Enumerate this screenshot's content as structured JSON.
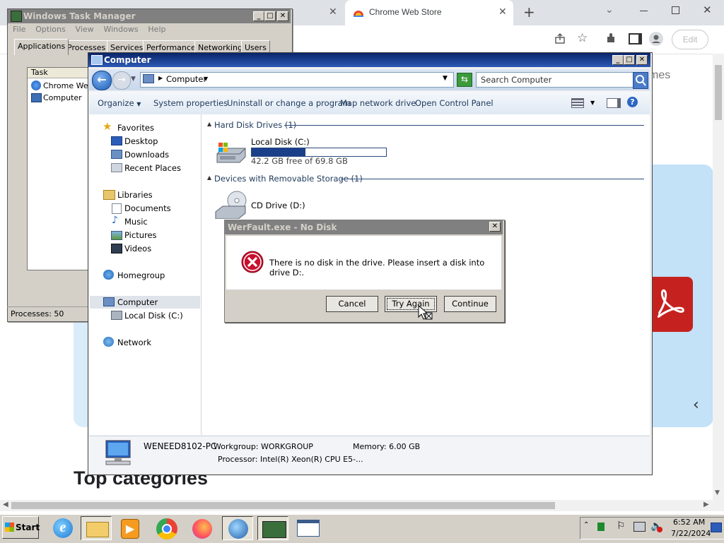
{
  "chrome": {
    "tab_active_title": "Chrome Web Store",
    "edit_label": "Edit",
    "games_partial": "mes",
    "top_categories": "Top categories"
  },
  "task_manager": {
    "title": "Windows Task Manager",
    "menus": [
      "File",
      "Options",
      "View",
      "Windows",
      "Help"
    ],
    "tabs": [
      "Applications",
      "Processes",
      "Services",
      "Performance",
      "Networking",
      "Users"
    ],
    "list_header": "Task",
    "list_items": [
      "Chrome Web",
      "Computer"
    ],
    "status": "Processes: 50"
  },
  "explorer": {
    "title": "Computer",
    "address": "Computer",
    "search_placeholder": "Search Computer",
    "commands": [
      "Organize",
      "System properties",
      "Uninstall or change a program",
      "Map network drive",
      "Open Control Panel"
    ],
    "nav": {
      "favorites": "Favorites",
      "desktop": "Desktop",
      "downloads": "Downloads",
      "recent": "Recent Places",
      "libraries": "Libraries",
      "documents": "Documents",
      "music": "Music",
      "pictures": "Pictures",
      "videos": "Videos",
      "homegroup": "Homegroup",
      "computer": "Computer",
      "local_disk": "Local Disk (C:)",
      "network": "Network"
    },
    "groups": {
      "hdd": "Hard Disk Drives (1)",
      "removable": "Devices with Removable Storage (1)"
    },
    "drive_c": {
      "name": "Local Disk (C:)",
      "free_text": "42.2 GB free of 69.8 GB",
      "used_fraction": 0.4
    },
    "drive_d": {
      "name": "CD Drive (D:)"
    },
    "details": {
      "pc_name": "WENEED8102-PC",
      "workgroup": "Workgroup: WORKGROUP",
      "memory": "Memory: 6.00 GB",
      "processor": "Processor: Intel(R) Xeon(R) CPU E5-..."
    }
  },
  "dialog": {
    "title": "WerFault.exe - No Disk",
    "message": "There is no disk in the drive. Please insert a disk into drive D:.",
    "buttons": {
      "cancel": "Cancel",
      "try_again": "Try Again",
      "continue": "Continue"
    }
  },
  "taskbar": {
    "start": "Start",
    "time": "6:52 AM",
    "date": "7/22/2024"
  },
  "colors": {
    "title_active": "#0a246a",
    "drive_fill": "#1c3f8a",
    "error_red": "#c8102e",
    "pdf_red": "#c5221f"
  }
}
